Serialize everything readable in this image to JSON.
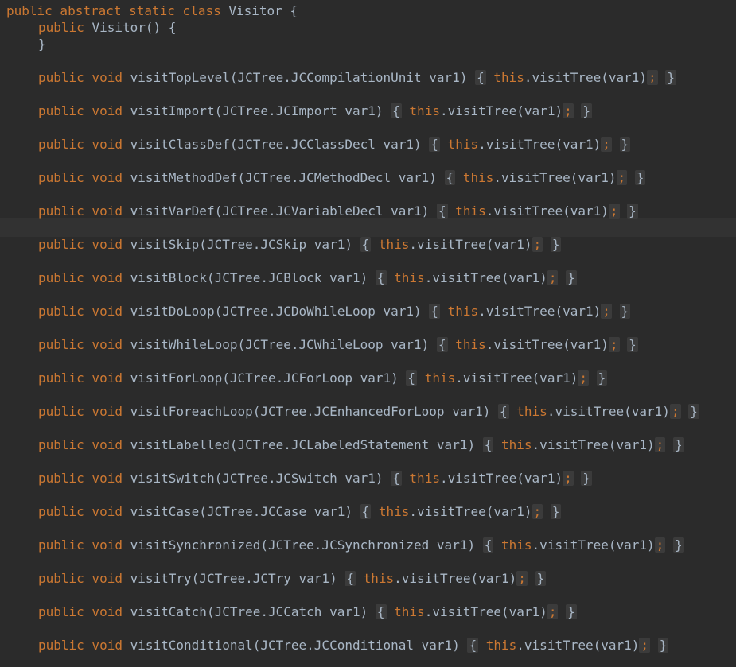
{
  "header": {
    "decl_keywords": "public abstract static class",
    "class_name": "Visitor",
    "open_brace": "{",
    "ctor_kw": "public",
    "ctor_sig": "Visitor() {",
    "ctor_close": "}"
  },
  "tokens": {
    "modifiers": "public void",
    "this_kw": "this",
    "call": ".visitTree(var1)",
    "semicolon": ";",
    "fold_open": "{",
    "fold_close": "}"
  },
  "methods": [
    {
      "sig": "visitTopLevel(JCTree.JCCompilationUnit var1)"
    },
    {
      "sig": "visitImport(JCTree.JCImport var1)"
    },
    {
      "sig": "visitClassDef(JCTree.JCClassDecl var1)"
    },
    {
      "sig": "visitMethodDef(JCTree.JCMethodDecl var1)"
    },
    {
      "sig": "visitVarDef(JCTree.JCVariableDecl var1)"
    },
    {
      "sig": "visitSkip(JCTree.JCSkip var1)"
    },
    {
      "sig": "visitBlock(JCTree.JCBlock var1)"
    },
    {
      "sig": "visitDoLoop(JCTree.JCDoWhileLoop var1)"
    },
    {
      "sig": "visitWhileLoop(JCTree.JCWhileLoop var1)"
    },
    {
      "sig": "visitForLoop(JCTree.JCForLoop var1)"
    },
    {
      "sig": "visitForeachLoop(JCTree.JCEnhancedForLoop var1)"
    },
    {
      "sig": "visitLabelled(JCTree.JCLabeledStatement var1)"
    },
    {
      "sig": "visitSwitch(JCTree.JCSwitch var1)"
    },
    {
      "sig": "visitCase(JCTree.JCCase var1)"
    },
    {
      "sig": "visitSynchronized(JCTree.JCSynchronized var1)"
    },
    {
      "sig": "visitTry(JCTree.JCTry var1)"
    },
    {
      "sig": "visitCatch(JCTree.JCCatch var1)"
    },
    {
      "sig": "visitConditional(JCTree.JCConditional var1)"
    }
  ]
}
